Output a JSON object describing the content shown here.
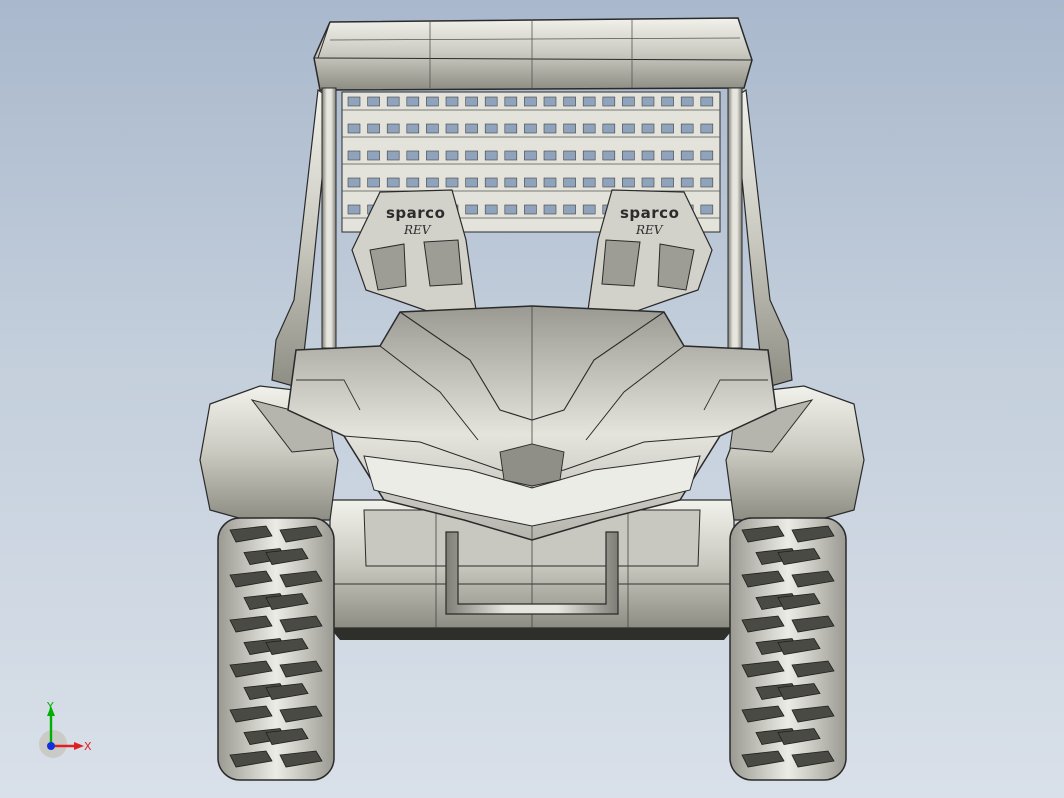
{
  "viewport": {
    "background_top": "#a9b8cc",
    "background_bottom": "#d9e0e9"
  },
  "model": {
    "subject": "UTV buggy front view",
    "body_color": "#d8d8d0",
    "edge_color": "#2a2a2a",
    "tire_color": "#cfcfc8",
    "seats": [
      {
        "brand": "sparco",
        "script": "REV"
      },
      {
        "brand": "sparco",
        "script": "REV"
      }
    ]
  },
  "triad": {
    "y_label": "Y",
    "x_label": "X",
    "y_color": "#00b000",
    "x_color": "#e02020",
    "z_color": "#1030e0"
  }
}
